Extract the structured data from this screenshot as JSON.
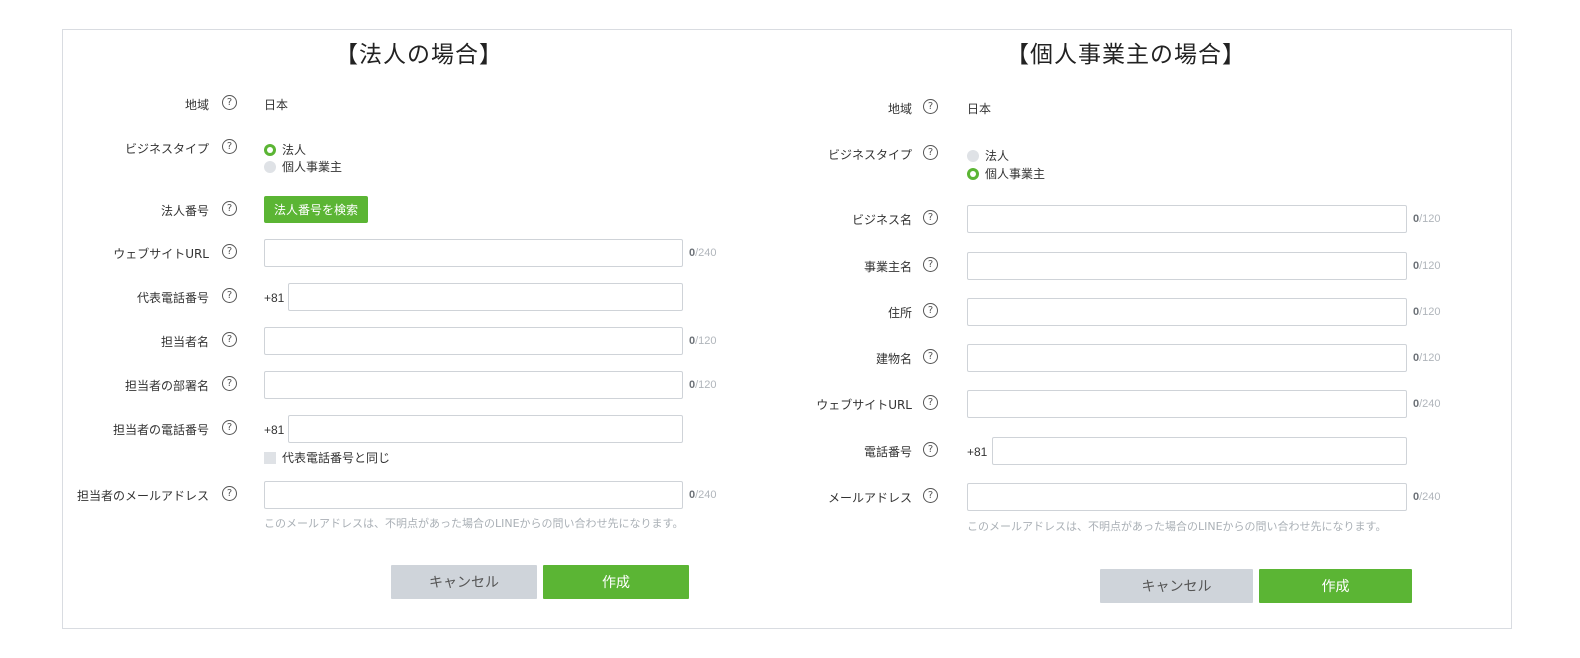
{
  "left": {
    "title": "【法人の場合】",
    "region": {
      "label": "地域",
      "value": "日本"
    },
    "business_type": {
      "label": "ビジネスタイプ",
      "options": [
        "法人",
        "個人事業主"
      ],
      "selected": 0
    },
    "corp_number": {
      "label": "法人番号",
      "button": "法人番号を検索"
    },
    "website": {
      "label": "ウェブサイトURL",
      "value": "",
      "count": "0",
      "max": "/240"
    },
    "main_phone": {
      "label": "代表電話番号",
      "prefix": "+81",
      "value": ""
    },
    "contact_name": {
      "label": "担当者名",
      "value": "",
      "count": "0",
      "max": "/120"
    },
    "contact_dept": {
      "label": "担当者の部署名",
      "value": "",
      "count": "0",
      "max": "/120"
    },
    "contact_phone": {
      "label": "担当者の電話番号",
      "prefix": "+81",
      "value": "",
      "same_as_label": "代表電話番号と同じ"
    },
    "contact_email": {
      "label": "担当者のメールアドレス",
      "value": "",
      "count": "0",
      "max": "/240",
      "hint": "このメールアドレスは、不明点があった場合のLINEからの問い合わせ先になります。"
    },
    "cancel": "キャンセル",
    "create": "作成"
  },
  "right": {
    "title": "【個人事業主の場合】",
    "region": {
      "label": "地域",
      "value": "日本"
    },
    "business_type": {
      "label": "ビジネスタイプ",
      "options": [
        "法人",
        "個人事業主"
      ],
      "selected": 1
    },
    "business_name": {
      "label": "ビジネス名",
      "value": "",
      "count": "0",
      "max": "/120"
    },
    "owner_name": {
      "label": "事業主名",
      "value": "",
      "count": "0",
      "max": "/120"
    },
    "address": {
      "label": "住所",
      "value": "",
      "count": "0",
      "max": "/120"
    },
    "building": {
      "label": "建物名",
      "value": "",
      "count": "0",
      "max": "/120"
    },
    "website": {
      "label": "ウェブサイトURL",
      "value": "",
      "count": "0",
      "max": "/240"
    },
    "phone": {
      "label": "電話番号",
      "prefix": "+81",
      "value": ""
    },
    "email": {
      "label": "メールアドレス",
      "value": "",
      "count": "0",
      "max": "/240",
      "hint": "このメールアドレスは、不明点があった場合のLINEからの問い合わせ先になります。"
    },
    "cancel": "キャンセル",
    "create": "作成"
  },
  "help_glyph": "?",
  "colors": {
    "accent": "#5bb534",
    "cancel_bg": "#cfd4da",
    "border": "#d9dce1"
  }
}
